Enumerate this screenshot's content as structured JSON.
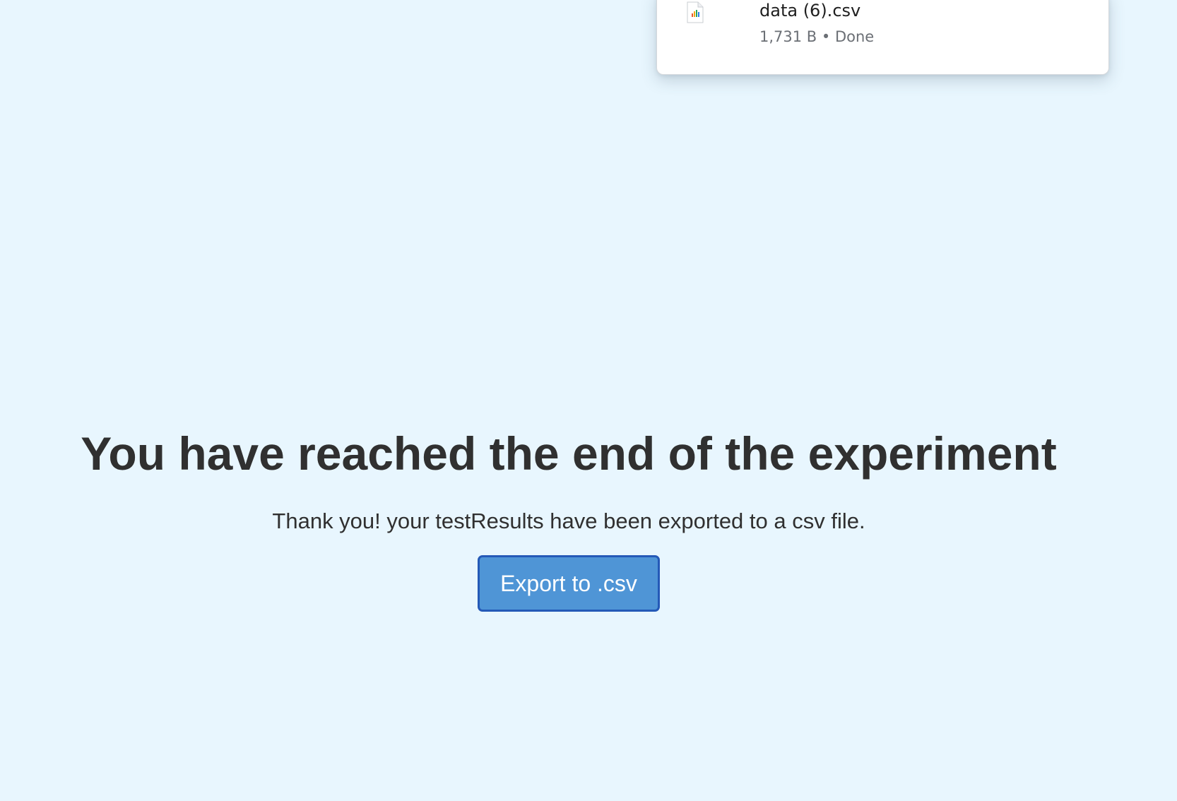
{
  "downloads": {
    "items": [
      {
        "file_name": "data (6).csv",
        "meta": "1,731 B • Done",
        "icon": "csv-file-icon"
      }
    ]
  },
  "main": {
    "title": "You have reached the end of the experiment",
    "message": "Thank you! your testResults have been exported to a csv file.",
    "export_button_label": "Export to .csv"
  },
  "colors": {
    "page_background": "#e8f6fe",
    "button_background": "#4f95d6",
    "button_border": "#2459b7",
    "text": "#303030"
  }
}
